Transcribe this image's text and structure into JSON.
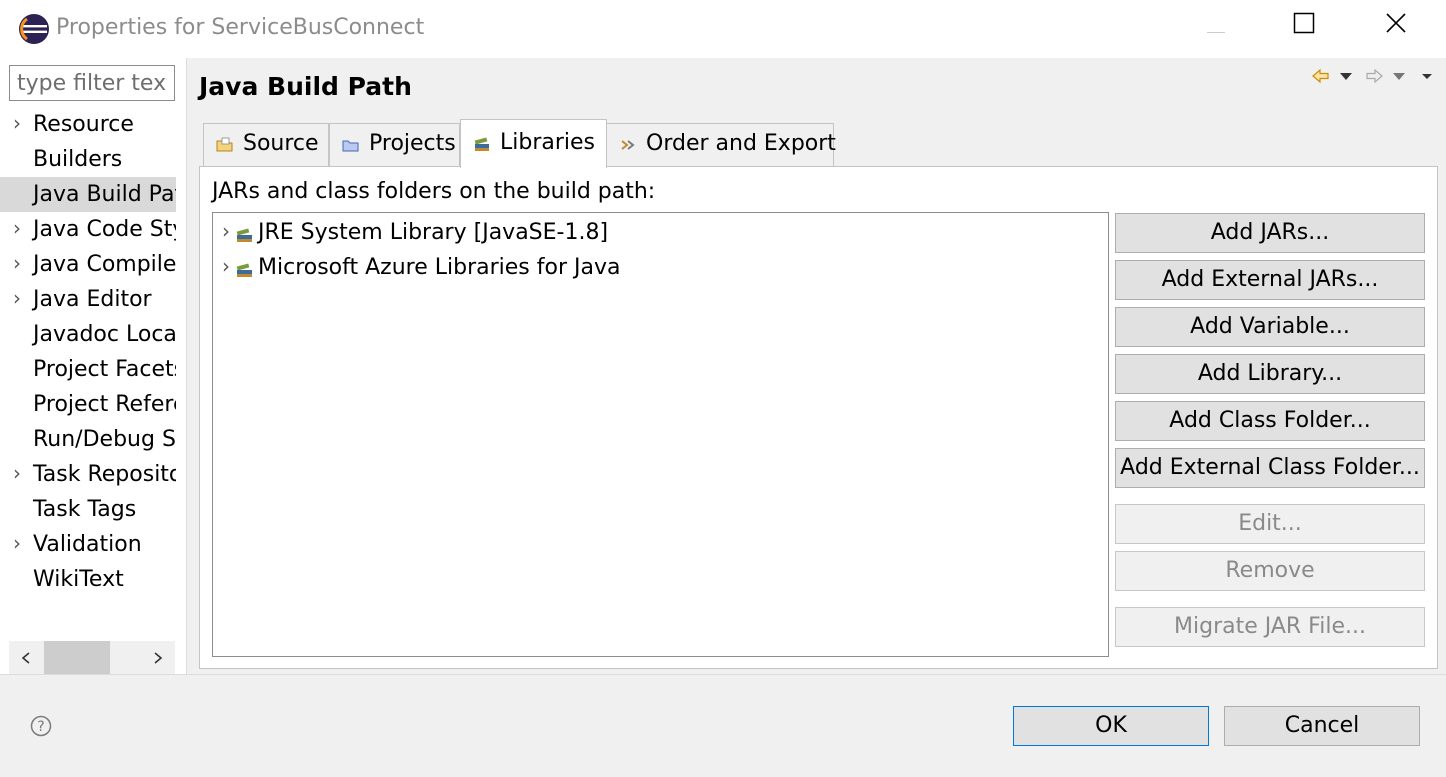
{
  "window": {
    "title": "Properties for ServiceBusConnect"
  },
  "filter": {
    "placeholder": "type filter text"
  },
  "nav": {
    "items": [
      {
        "label": "Resource",
        "expandable": true
      },
      {
        "label": "Builders",
        "expandable": false
      },
      {
        "label": "Java Build Path",
        "expandable": false,
        "selected": true
      },
      {
        "label": "Java Code Style",
        "expandable": true
      },
      {
        "label": "Java Compiler",
        "expandable": true
      },
      {
        "label": "Java Editor",
        "expandable": true
      },
      {
        "label": "Javadoc Location",
        "expandable": false
      },
      {
        "label": "Project Facets",
        "expandable": false
      },
      {
        "label": "Project References",
        "expandable": false
      },
      {
        "label": "Run/Debug Settings",
        "expandable": false
      },
      {
        "label": "Task Repository",
        "expandable": true
      },
      {
        "label": "Task Tags",
        "expandable": false
      },
      {
        "label": "Validation",
        "expandable": true
      },
      {
        "label": "WikiText",
        "expandable": false
      }
    ]
  },
  "page": {
    "title": "Java Build Path"
  },
  "tabs": [
    {
      "label": "Source",
      "icon": "source-folder-icon"
    },
    {
      "label": "Projects",
      "icon": "project-folder-icon"
    },
    {
      "label": "Libraries",
      "icon": "library-icon",
      "active": true
    },
    {
      "label": "Order and Export",
      "icon": "order-export-icon"
    }
  ],
  "libraries": {
    "label": "JARs and class folders on the build path:",
    "entries": [
      {
        "label": "JRE System Library [JavaSE-1.8]",
        "icon": "library-icon"
      },
      {
        "label": "Microsoft Azure Libraries for Java",
        "icon": "library-icon"
      }
    ]
  },
  "buttons": {
    "add_jars": "Add JARs...",
    "add_external_jars": "Add External JARs...",
    "add_variable": "Add Variable...",
    "add_library": "Add Library...",
    "add_class_folder": "Add Class Folder...",
    "add_external_class_folder": "Add External Class Folder...",
    "edit": "Edit...",
    "remove": "Remove",
    "migrate_jar": "Migrate JAR File..."
  },
  "footer": {
    "ok": "OK",
    "cancel": "Cancel"
  },
  "colors": {
    "accent": "#0078d7",
    "eclipse_purple": "#2c2255",
    "eclipse_orange": "#f7941e"
  }
}
